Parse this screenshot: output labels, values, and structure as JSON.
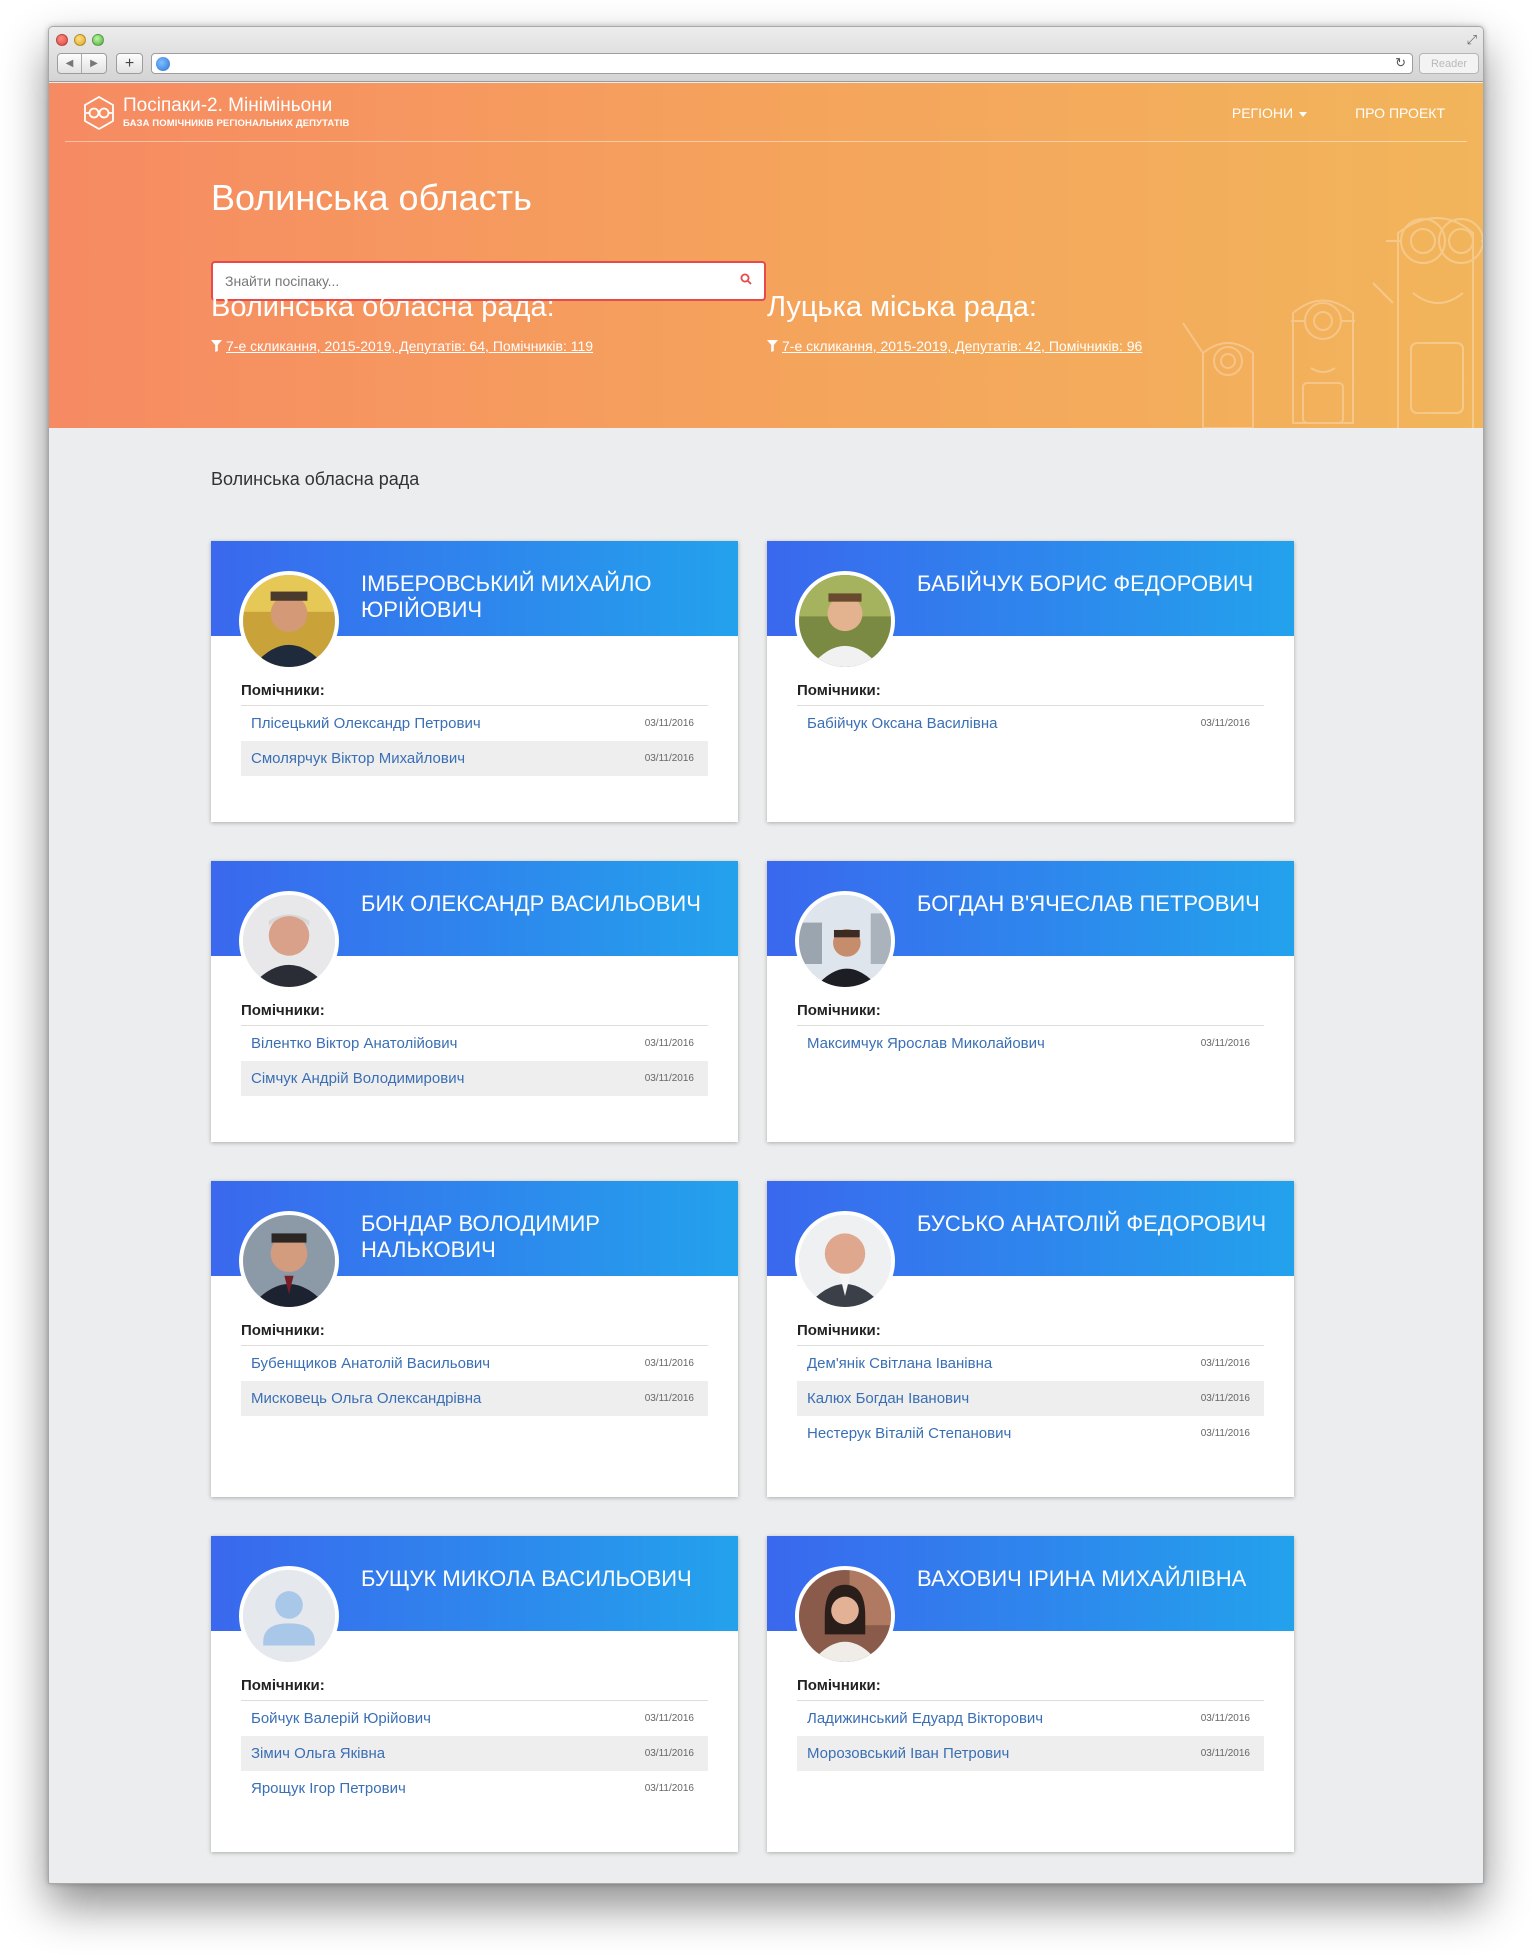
{
  "site": {
    "title": "Посіпаки-2. Мініміньони",
    "subtitle": "БАЗА ПОМІЧНИКІВ РЕГІОНАЛЬНИХ ДЕПУТАТІВ",
    "nav": {
      "regions": "РЕГІОНИ",
      "about": "ПРО ПРОЕКТ"
    }
  },
  "browser": {
    "reader": "Reader"
  },
  "region": {
    "title": "Волинська область",
    "search_placeholder": "Знайти посіпаку..."
  },
  "councils": [
    {
      "name": "Волинська обласна рада:",
      "info": "7-е скликання, 2015-2019, Депутатів: 64, Помічників: 119"
    },
    {
      "name": "Луцька міська рада:",
      "info": "7-е скликання, 2015-2019, Депутатів: 42, Помічників: 96"
    }
  ],
  "section_title": "Волинська обласна рада",
  "assistants_label": "Помічники:",
  "deputies": [
    {
      "name": "Імберовський Михайло Юрійович",
      "photo": "photo-man-yellow",
      "assistants": [
        {
          "name": "Плісецький Олександр Петрович",
          "date": "03/11/2016"
        },
        {
          "name": "Смолярчук Віктор Михайлович",
          "date": "03/11/2016"
        }
      ]
    },
    {
      "name": "Бабійчук Борис Федорович",
      "photo": "photo-man-green",
      "assistants": [
        {
          "name": "Бабійчук Оксана Василівна",
          "date": "03/11/2016"
        }
      ]
    },
    {
      "name": "Бик Олександр Васильович",
      "photo": "photo-man-gray",
      "assistants": [
        {
          "name": "Вілентко Віктор Анатолійович",
          "date": "03/11/2016"
        },
        {
          "name": "Сімчук Андрій Володимирович",
          "date": "03/11/2016"
        }
      ]
    },
    {
      "name": "Богдан В'ячеслав Петрович",
      "photo": "photo-man-street",
      "assistants": [
        {
          "name": "Максимчук Ярослав Миколайович",
          "date": "03/11/2016"
        }
      ]
    },
    {
      "name": "Бондар Володимир Налькович",
      "photo": "photo-man-suit",
      "assistants": [
        {
          "name": "Бубенщиков Анатолій Васильович",
          "date": "03/11/2016"
        },
        {
          "name": "Мисковець Ольга Олександрівна",
          "date": "03/11/2016"
        }
      ]
    },
    {
      "name": "Бусько Анатолій Федорович",
      "photo": "photo-man-light",
      "assistants": [
        {
          "name": "Дем'янік Світлана Іванівна",
          "date": "03/11/2016"
        },
        {
          "name": "Калюх Богдан Іванович",
          "date": "03/11/2016"
        },
        {
          "name": "Нестерук Віталій Степанович",
          "date": "03/11/2016"
        }
      ]
    },
    {
      "name": "Бущук Микола Васильович",
      "photo": "placeholder-user-icon",
      "assistants": [
        {
          "name": "Бойчук Валерій Юрійович",
          "date": "03/11/2016"
        },
        {
          "name": "Зімич Ольга Яківна",
          "date": "03/11/2016"
        },
        {
          "name": "Ярощук Ігор Петрович",
          "date": "03/11/2016"
        }
      ]
    },
    {
      "name": "Вахович Ірина Михайлівна",
      "photo": "photo-woman",
      "assistants": [
        {
          "name": "Ладижинський Едуард Вікторович",
          "date": "03/11/2016"
        },
        {
          "name": "Морозовський Іван Петрович",
          "date": "03/11/2016"
        }
      ]
    }
  ],
  "colors": {
    "header_gradient_start": "#f68a63",
    "header_gradient_end": "#f2b55b",
    "card_gradient_start": "#3a68ee",
    "card_gradient_end": "#23a2ec",
    "search_border": "#e74a4a",
    "link": "#3a6fb5"
  }
}
